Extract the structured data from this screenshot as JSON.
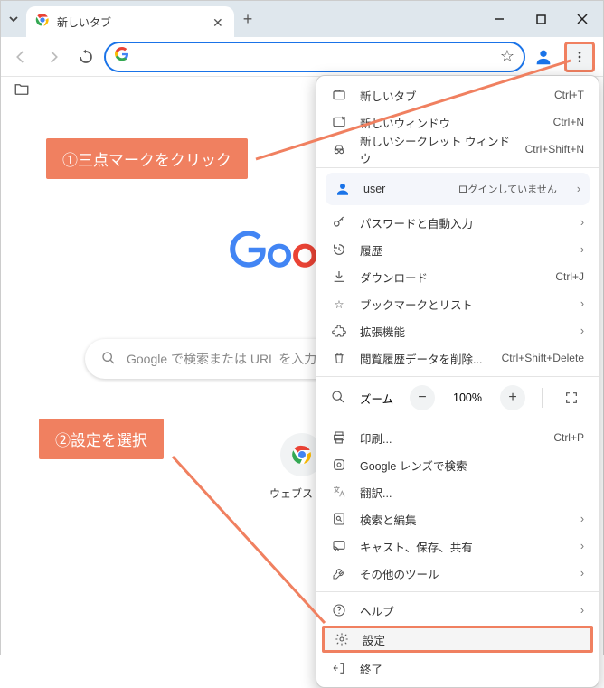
{
  "titlebar": {
    "tab_title": "新しいタブ"
  },
  "search_placeholder": "Google で検索または URL を入力",
  "shortcut_label": "ウェブストア",
  "callout1": "①三点マークをクリック",
  "callout2": "②設定を選択",
  "menu": {
    "new_tab": "新しいタブ",
    "new_tab_sc": "Ctrl+T",
    "new_window": "新しいウィンドウ",
    "new_window_sc": "Ctrl+N",
    "new_incognito": "新しいシークレット ウィンドウ",
    "new_incognito_sc": "Ctrl+Shift+N",
    "user_name": "user",
    "user_status": "ログインしていません",
    "passwords": "パスワードと自動入力",
    "history": "履歴",
    "downloads": "ダウンロード",
    "downloads_sc": "Ctrl+J",
    "bookmarks": "ブックマークとリスト",
    "extensions": "拡張機能",
    "clear_data": "閲覧履歴データを削除...",
    "clear_data_sc": "Ctrl+Shift+Delete",
    "zoom_label": "ズーム",
    "zoom_pct": "100%",
    "print": "印刷...",
    "print_sc": "Ctrl+P",
    "lens": "Google レンズで検索",
    "translate": "翻訳...",
    "find": "検索と編集",
    "cast": "キャスト、保存、共有",
    "more_tools": "その他のツール",
    "help": "ヘルプ",
    "settings": "設定",
    "exit": "終了"
  }
}
